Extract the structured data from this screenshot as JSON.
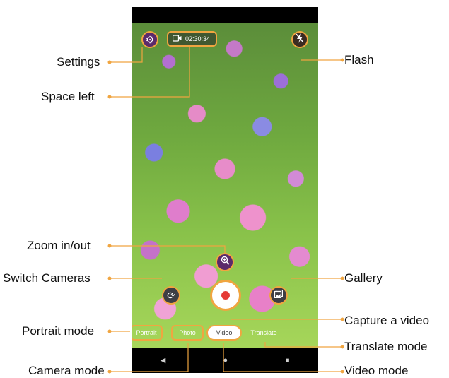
{
  "status": {
    "timer": "02:30:34"
  },
  "camera_modes": [
    {
      "label": "Portrait"
    },
    {
      "label": "Photo"
    },
    {
      "label": "Video"
    },
    {
      "label": "Translate"
    }
  ],
  "callouts": {
    "settings": "Settings",
    "space_left": "Space left",
    "flash": "Flash",
    "zoom": "Zoom in/out",
    "switch_cameras": "Switch Cameras",
    "gallery": "Gallery",
    "capture_video": "Capture a video",
    "portrait_mode": "Portrait mode",
    "translate_mode": "Translate mode",
    "camera_mode": "Camera mode",
    "video_mode": "Video mode"
  },
  "icons": {
    "settings": "gear-icon",
    "video": "video-camera-icon",
    "flash": "flash-off-icon",
    "zoom": "zoom-in-icon",
    "switch": "switch-camera-icon",
    "gallery": "gallery-icon",
    "back": "back-triangle-icon",
    "home": "home-circle-icon",
    "recents": "recents-square-icon"
  },
  "colors": {
    "accent": "#f0a540",
    "record": "#e53935",
    "control_bg": "#5b2a6b"
  }
}
